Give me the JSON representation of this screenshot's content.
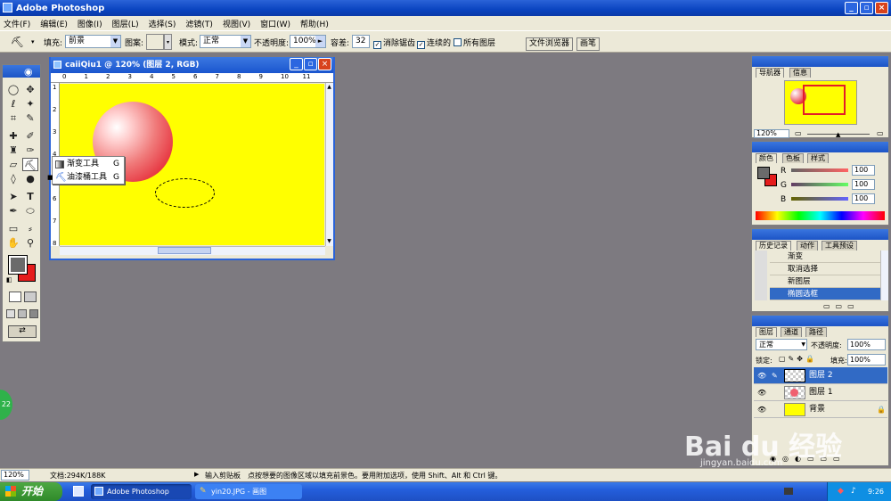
{
  "app": {
    "title": "Adobe Photoshop"
  },
  "menu": [
    "文件(F)",
    "编辑(E)",
    "图像(I)",
    "图层(L)",
    "选择(S)",
    "滤镜(T)",
    "视图(V)",
    "窗口(W)",
    "帮助(H)"
  ],
  "options": {
    "fill_label": "填充:",
    "fill_value": "前景",
    "pattern_label": "图案:",
    "mode_label": "模式:",
    "mode_value": "正常",
    "opacity_label": "不透明度:",
    "opacity_value": "100%",
    "tolerance_label": "容差:",
    "tolerance_value": "32",
    "antialias_label": "消除锯齿",
    "contiguous_label": "连续的",
    "alllayers_label": "所有图层",
    "tab_browser": "文件浏览器",
    "tab_brushes": "画笔"
  },
  "document": {
    "title": "caiiQiu1 @ 120% (图层 2, RGB)",
    "ruler_ticks": [
      "0",
      "1",
      "2",
      "3",
      "4",
      "5",
      "6",
      "7",
      "8",
      "9",
      "10",
      "11"
    ],
    "ruler_v": [
      "1",
      "2",
      "3",
      "4",
      "5",
      "6",
      "7",
      "8"
    ]
  },
  "flyout": {
    "items": [
      {
        "label": "渐变工具",
        "key": "G"
      },
      {
        "label": "油漆桶工具",
        "key": "G"
      }
    ]
  },
  "navigator": {
    "tab1": "导航器",
    "tab2": "信息",
    "zoom": "120%"
  },
  "color": {
    "tab1": "颜色",
    "tab2": "色板",
    "tab3": "样式",
    "r_label": "R",
    "g_label": "G",
    "b_label": "B",
    "r": "100",
    "g": "100",
    "b": "100"
  },
  "history": {
    "tab1": "历史记录",
    "tab2": "动作",
    "tab3": "工具预设",
    "items": [
      "渐变",
      "取消选择",
      "新图层",
      "椭圆选框"
    ]
  },
  "layers": {
    "tab1": "图层",
    "tab2": "通道",
    "tab3": "路径",
    "blend": "正常",
    "opacity_label": "不透明度:",
    "opacity": "100%",
    "lock_label": "锁定:",
    "fill_label": "填充:",
    "fill": "100%",
    "items": [
      "图层 2",
      "图层 1",
      "背景"
    ]
  },
  "status": {
    "zoom": "120%",
    "doc_size": "文档:294K/188K",
    "hint": "输入剪贴板　点按想要的图像区域以填充前景色。要用附加选项，使用 Shift、Alt 和 Ctrl 键。"
  },
  "taskbar": {
    "start": "开始",
    "tasks": [
      "Adobe Photoshop",
      "yin20.JPG - 画图"
    ],
    "clock": "9:26"
  },
  "watermark": {
    "line1": "Bai du 经验",
    "line2": "jingyan.baidu.com"
  },
  "badge": "22"
}
